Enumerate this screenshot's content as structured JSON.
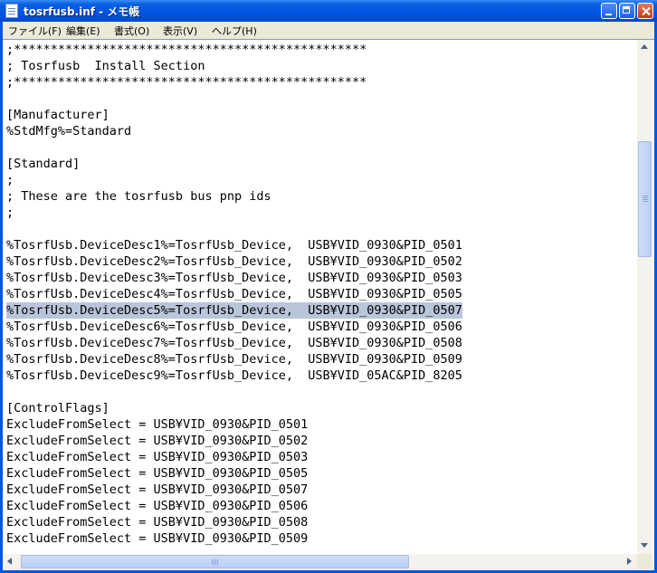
{
  "window": {
    "title": "tosrfusb.inf - メモ帳",
    "titlebar_color": "#0054E3"
  },
  "menu": [
    "ファイル(F)",
    "編集(E)",
    "書式(O)",
    "表示(V)",
    "ヘルプ(H)"
  ],
  "editor": {
    "selection_color": "#B9C6DA",
    "selected_line_index": 16,
    "lines": [
      ";************************************************",
      "; Tosrfusb  Install Section",
      ";************************************************",
      "",
      "[Manufacturer]",
      "%StdMfg%=Standard",
      "",
      "[Standard]",
      ";",
      "; These are the tosrfusb bus pnp ids",
      ";",
      "",
      "%TosrfUsb.DeviceDesc1%=TosrfUsb_Device,  USB¥VID_0930&PID_0501",
      "%TosrfUsb.DeviceDesc2%=TosrfUsb_Device,  USB¥VID_0930&PID_0502",
      "%TosrfUsb.DeviceDesc3%=TosrfUsb_Device,  USB¥VID_0930&PID_0503",
      "%TosrfUsb.DeviceDesc4%=TosrfUsb_Device,  USB¥VID_0930&PID_0505",
      "%TosrfUsb.DeviceDesc5%=TosrfUsb_Device,  USB¥VID_0930&PID_0507",
      "%TosrfUsb.DeviceDesc6%=TosrfUsb_Device,  USB¥VID_0930&PID_0506",
      "%TosrfUsb.DeviceDesc7%=TosrfUsb_Device,  USB¥VID_0930&PID_0508",
      "%TosrfUsb.DeviceDesc8%=TosrfUsb_Device,  USB¥VID_0930&PID_0509",
      "%TosrfUsb.DeviceDesc9%=TosrfUsb_Device,  USB¥VID_05AC&PID_8205",
      "",
      "[ControlFlags]",
      "ExcludeFromSelect = USB¥VID_0930&PID_0501",
      "ExcludeFromSelect = USB¥VID_0930&PID_0502",
      "ExcludeFromSelect = USB¥VID_0930&PID_0503",
      "ExcludeFromSelect = USB¥VID_0930&PID_0505",
      "ExcludeFromSelect = USB¥VID_0930&PID_0507",
      "ExcludeFromSelect = USB¥VID_0930&PID_0506",
      "ExcludeFromSelect = USB¥VID_0930&PID_0508",
      "ExcludeFromSelect = USB¥VID_0930&PID_0509"
    ]
  }
}
